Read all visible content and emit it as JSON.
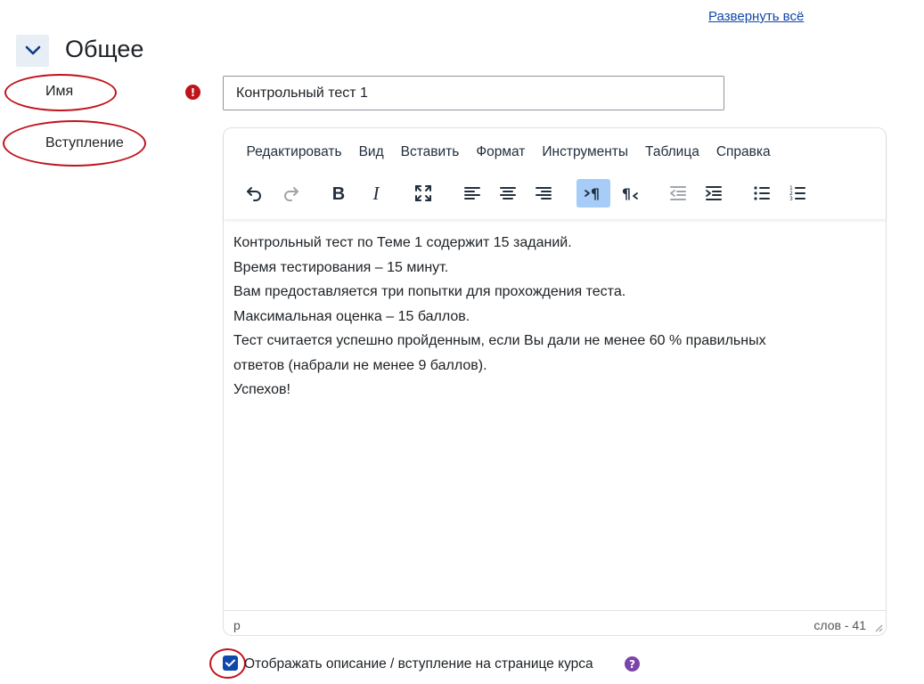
{
  "header": {
    "expand_all_label": "Развернуть всё"
  },
  "section": {
    "title": "Общее",
    "toggle_icon": "chevron-down-icon"
  },
  "fields": {
    "name": {
      "label": "Имя",
      "value": "Контрольный тест 1",
      "required_icon": "!"
    },
    "intro": {
      "label": "Вступление"
    }
  },
  "editor": {
    "menu": [
      "Редактировать",
      "Вид",
      "Вставить",
      "Формат",
      "Инструменты",
      "Таблица",
      "Справка"
    ],
    "toolbar": [
      "undo-icon",
      "redo-icon",
      "bold-icon",
      "italic-icon",
      "fullscreen-icon",
      "align-left-icon",
      "align-center-icon",
      "align-right-icon",
      "ltr-icon",
      "rtl-icon",
      "outdent-icon",
      "indent-icon",
      "bullet-list-icon",
      "numbered-list-icon"
    ],
    "content_lines": [
      "Контрольный тест по Теме 1 содержит 15 заданий.",
      "Время тестирования – 15 минут.",
      "Вам предоставляется три попытки для прохождения теста.",
      "Максимальная оценка – 15 баллов.",
      "Тест считается успешно пройденным, если Вы дали не менее 60 % правильных",
      "ответов (набрали не менее 9 баллов).",
      "Успехов!"
    ],
    "status_path": "p",
    "word_count": "слов - 41"
  },
  "show_description": {
    "checked": true,
    "label": "Отображать описание / вступление на странице курса",
    "help_icon": "?"
  },
  "colors": {
    "accent": "#0f47ad",
    "annotation": "#c0141c",
    "help": "#7b45a8",
    "active_button": "#a6ccf7"
  }
}
